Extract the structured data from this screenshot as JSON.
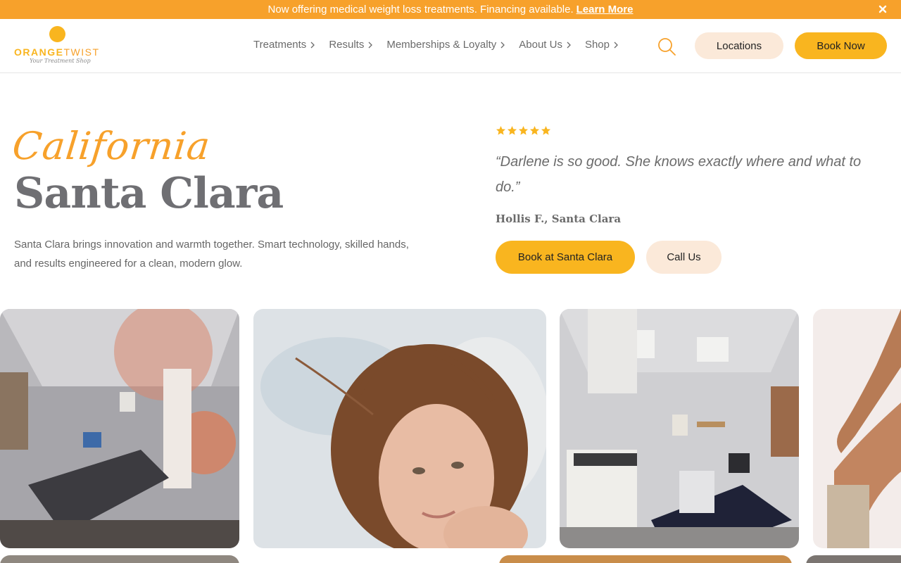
{
  "announcement": {
    "text": "Now offering medical weight loss treatments. Financing available.",
    "link_label": "Learn More"
  },
  "brand": {
    "name_bold": "ORANGE",
    "name_light": "TWIST",
    "tagline": "Your Treatment Shop",
    "accent_color": "#f9b51f",
    "bar_color": "#f7a12b"
  },
  "nav": {
    "items": [
      {
        "label": "Treatments"
      },
      {
        "label": "Results"
      },
      {
        "label": "Memberships & Loyalty"
      },
      {
        "label": "About Us"
      },
      {
        "label": "Shop"
      }
    ],
    "locations_label": "Locations",
    "book_label": "Book Now"
  },
  "hero": {
    "state": "California",
    "city": "Santa Clara",
    "description": "Santa Clara brings innovation and warmth together. Smart technology, skilled hands, and results engineered for a clean, modern glow."
  },
  "review": {
    "rating": 5,
    "quote": "“Darlene is so good. She knows exactly where and what to do.”",
    "author": "Hollis F., Santa Clara",
    "book_label": "Book at Santa Clara",
    "call_label": "Call Us"
  },
  "gallery": {
    "photos": [
      {
        "name": "treatment-room-photo"
      },
      {
        "name": "woman-portrait-photo"
      },
      {
        "name": "clinic-room-photo"
      },
      {
        "name": "arm-photo"
      }
    ]
  }
}
